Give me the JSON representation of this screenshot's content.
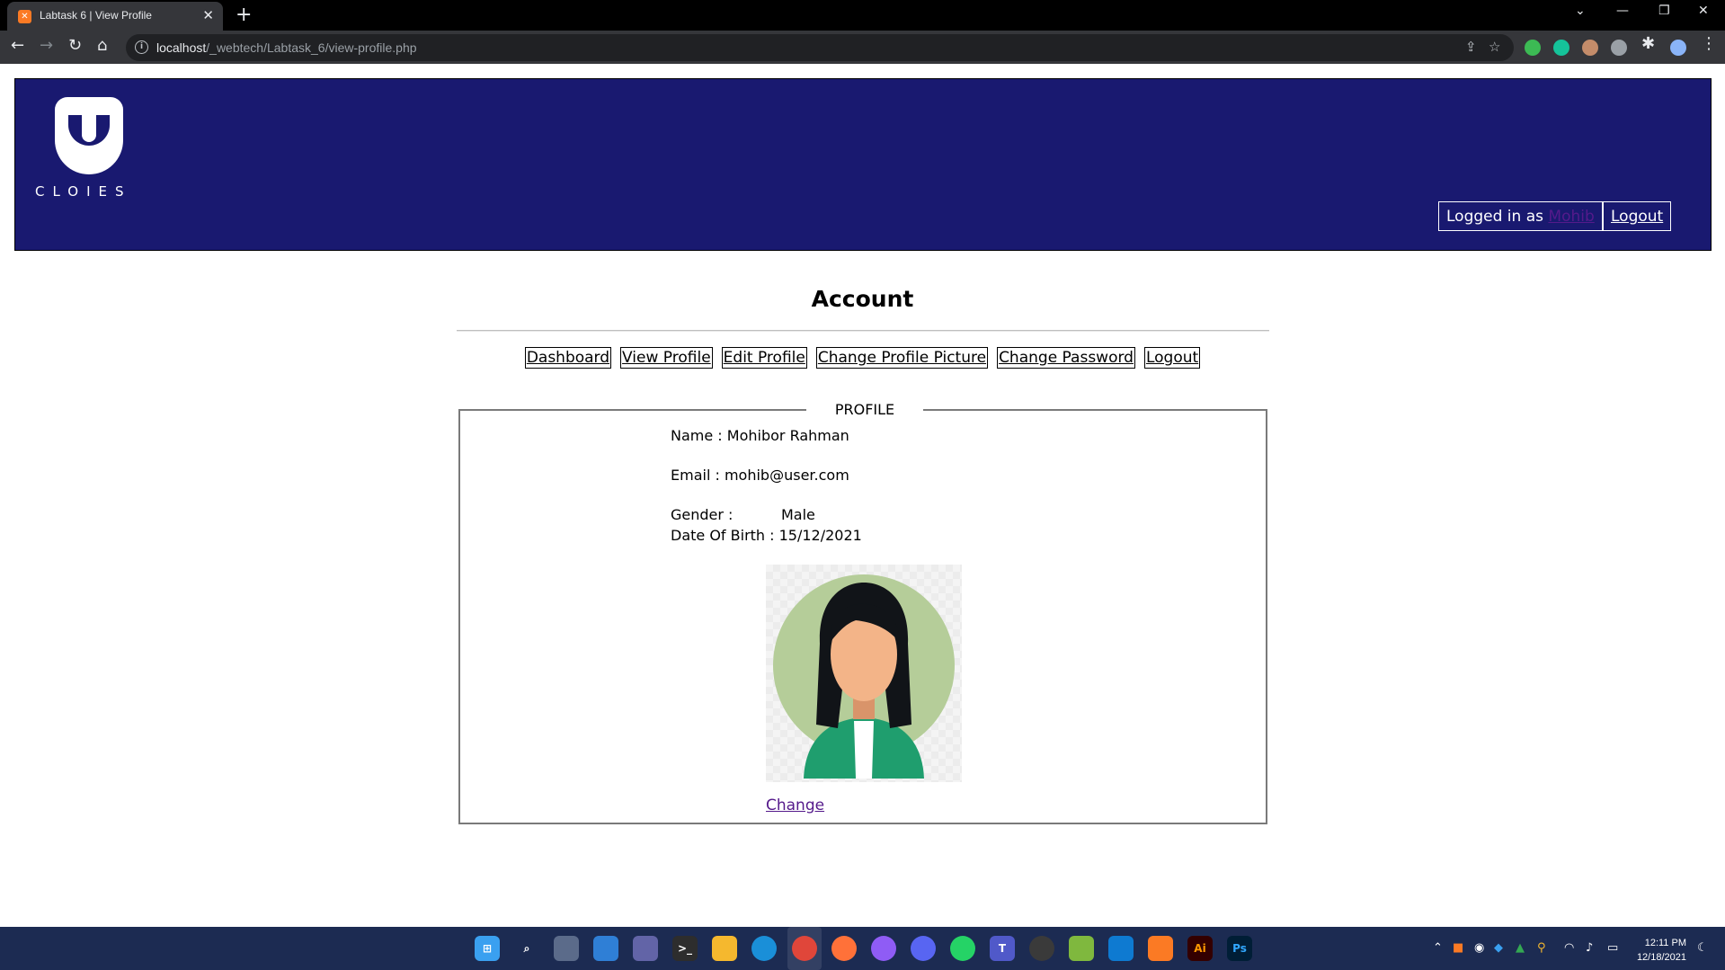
{
  "browser": {
    "tab_title": "Labtask 6 | View Profile",
    "tab_favicon": "xampp-icon",
    "url_host": "localhost",
    "url_path": "/_webtech/Labtask_6/view-profile.php"
  },
  "header": {
    "logo_text": "CLOIES",
    "logged_in_label": "Logged in as",
    "username": "Mohib",
    "logout_label": "Logout",
    "background_color": "#191970"
  },
  "page": {
    "title": "Account",
    "menu": [
      {
        "label": "Dashboard"
      },
      {
        "label": "View Profile"
      },
      {
        "label": "Edit Profile"
      },
      {
        "label": "Change Profile Picture"
      },
      {
        "label": "Change Password"
      },
      {
        "label": "Logout"
      }
    ]
  },
  "profile": {
    "legend": "PROFILE",
    "name_label": "Name :",
    "name": "Mohibor Rahman",
    "email_label": "Email :",
    "email": "mohib@user.com",
    "gender_label": "Gender :",
    "gender": "Male",
    "dob_label": "Date Of Birth :",
    "dob": "15/12/2021",
    "avatar_icon": "female-avatar-icon",
    "change_label": "Change"
  },
  "taskbar": {
    "time": "12:11 PM",
    "date": "12/18/2021"
  }
}
